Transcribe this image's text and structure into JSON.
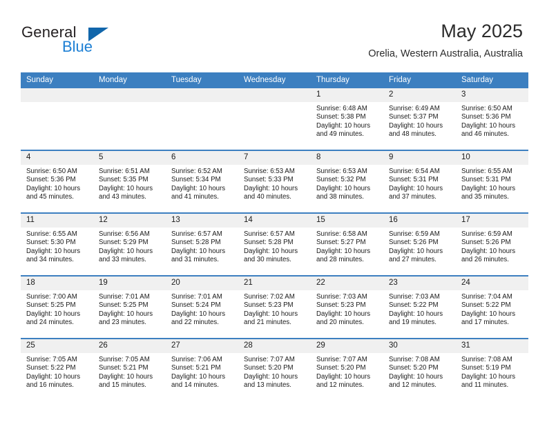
{
  "brand": {
    "word1": "General",
    "word2": "Blue",
    "logo_icon": "triangle-logo-icon",
    "accent_color": "#1c7fd4"
  },
  "header": {
    "title": "May 2025",
    "location": "Orelia, Western Australia, Australia"
  },
  "theme": {
    "header_blue": "#3c7fc0",
    "daynum_band": "#f0f0f0"
  },
  "weekday_headers": [
    "Sunday",
    "Monday",
    "Tuesday",
    "Wednesday",
    "Thursday",
    "Friday",
    "Saturday"
  ],
  "labels": {
    "sunrise_prefix": "Sunrise:",
    "sunset_prefix": "Sunset:",
    "daylight_prefix": "Daylight:"
  },
  "weeks": [
    [
      {
        "empty": true
      },
      {
        "empty": true
      },
      {
        "empty": true
      },
      {
        "empty": true
      },
      {
        "day": "1",
        "sunrise": "Sunrise: 6:48 AM",
        "sunset": "Sunset: 5:38 PM",
        "daylight1": "Daylight: 10 hours",
        "daylight2": "and 49 minutes."
      },
      {
        "day": "2",
        "sunrise": "Sunrise: 6:49 AM",
        "sunset": "Sunset: 5:37 PM",
        "daylight1": "Daylight: 10 hours",
        "daylight2": "and 48 minutes."
      },
      {
        "day": "3",
        "sunrise": "Sunrise: 6:50 AM",
        "sunset": "Sunset: 5:36 PM",
        "daylight1": "Daylight: 10 hours",
        "daylight2": "and 46 minutes."
      }
    ],
    [
      {
        "day": "4",
        "sunrise": "Sunrise: 6:50 AM",
        "sunset": "Sunset: 5:36 PM",
        "daylight1": "Daylight: 10 hours",
        "daylight2": "and 45 minutes."
      },
      {
        "day": "5",
        "sunrise": "Sunrise: 6:51 AM",
        "sunset": "Sunset: 5:35 PM",
        "daylight1": "Daylight: 10 hours",
        "daylight2": "and 43 minutes."
      },
      {
        "day": "6",
        "sunrise": "Sunrise: 6:52 AM",
        "sunset": "Sunset: 5:34 PM",
        "daylight1": "Daylight: 10 hours",
        "daylight2": "and 41 minutes."
      },
      {
        "day": "7",
        "sunrise": "Sunrise: 6:53 AM",
        "sunset": "Sunset: 5:33 PM",
        "daylight1": "Daylight: 10 hours",
        "daylight2": "and 40 minutes."
      },
      {
        "day": "8",
        "sunrise": "Sunrise: 6:53 AM",
        "sunset": "Sunset: 5:32 PM",
        "daylight1": "Daylight: 10 hours",
        "daylight2": "and 38 minutes."
      },
      {
        "day": "9",
        "sunrise": "Sunrise: 6:54 AM",
        "sunset": "Sunset: 5:31 PM",
        "daylight1": "Daylight: 10 hours",
        "daylight2": "and 37 minutes."
      },
      {
        "day": "10",
        "sunrise": "Sunrise: 6:55 AM",
        "sunset": "Sunset: 5:31 PM",
        "daylight1": "Daylight: 10 hours",
        "daylight2": "and 35 minutes."
      }
    ],
    [
      {
        "day": "11",
        "sunrise": "Sunrise: 6:55 AM",
        "sunset": "Sunset: 5:30 PM",
        "daylight1": "Daylight: 10 hours",
        "daylight2": "and 34 minutes."
      },
      {
        "day": "12",
        "sunrise": "Sunrise: 6:56 AM",
        "sunset": "Sunset: 5:29 PM",
        "daylight1": "Daylight: 10 hours",
        "daylight2": "and 33 minutes."
      },
      {
        "day": "13",
        "sunrise": "Sunrise: 6:57 AM",
        "sunset": "Sunset: 5:28 PM",
        "daylight1": "Daylight: 10 hours",
        "daylight2": "and 31 minutes."
      },
      {
        "day": "14",
        "sunrise": "Sunrise: 6:57 AM",
        "sunset": "Sunset: 5:28 PM",
        "daylight1": "Daylight: 10 hours",
        "daylight2": "and 30 minutes."
      },
      {
        "day": "15",
        "sunrise": "Sunrise: 6:58 AM",
        "sunset": "Sunset: 5:27 PM",
        "daylight1": "Daylight: 10 hours",
        "daylight2": "and 28 minutes."
      },
      {
        "day": "16",
        "sunrise": "Sunrise: 6:59 AM",
        "sunset": "Sunset: 5:26 PM",
        "daylight1": "Daylight: 10 hours",
        "daylight2": "and 27 minutes."
      },
      {
        "day": "17",
        "sunrise": "Sunrise: 6:59 AM",
        "sunset": "Sunset: 5:26 PM",
        "daylight1": "Daylight: 10 hours",
        "daylight2": "and 26 minutes."
      }
    ],
    [
      {
        "day": "18",
        "sunrise": "Sunrise: 7:00 AM",
        "sunset": "Sunset: 5:25 PM",
        "daylight1": "Daylight: 10 hours",
        "daylight2": "and 24 minutes."
      },
      {
        "day": "19",
        "sunrise": "Sunrise: 7:01 AM",
        "sunset": "Sunset: 5:25 PM",
        "daylight1": "Daylight: 10 hours",
        "daylight2": "and 23 minutes."
      },
      {
        "day": "20",
        "sunrise": "Sunrise: 7:01 AM",
        "sunset": "Sunset: 5:24 PM",
        "daylight1": "Daylight: 10 hours",
        "daylight2": "and 22 minutes."
      },
      {
        "day": "21",
        "sunrise": "Sunrise: 7:02 AM",
        "sunset": "Sunset: 5:23 PM",
        "daylight1": "Daylight: 10 hours",
        "daylight2": "and 21 minutes."
      },
      {
        "day": "22",
        "sunrise": "Sunrise: 7:03 AM",
        "sunset": "Sunset: 5:23 PM",
        "daylight1": "Daylight: 10 hours",
        "daylight2": "and 20 minutes."
      },
      {
        "day": "23",
        "sunrise": "Sunrise: 7:03 AM",
        "sunset": "Sunset: 5:22 PM",
        "daylight1": "Daylight: 10 hours",
        "daylight2": "and 19 minutes."
      },
      {
        "day": "24",
        "sunrise": "Sunrise: 7:04 AM",
        "sunset": "Sunset: 5:22 PM",
        "daylight1": "Daylight: 10 hours",
        "daylight2": "and 17 minutes."
      }
    ],
    [
      {
        "day": "25",
        "sunrise": "Sunrise: 7:05 AM",
        "sunset": "Sunset: 5:22 PM",
        "daylight1": "Daylight: 10 hours",
        "daylight2": "and 16 minutes."
      },
      {
        "day": "26",
        "sunrise": "Sunrise: 7:05 AM",
        "sunset": "Sunset: 5:21 PM",
        "daylight1": "Daylight: 10 hours",
        "daylight2": "and 15 minutes."
      },
      {
        "day": "27",
        "sunrise": "Sunrise: 7:06 AM",
        "sunset": "Sunset: 5:21 PM",
        "daylight1": "Daylight: 10 hours",
        "daylight2": "and 14 minutes."
      },
      {
        "day": "28",
        "sunrise": "Sunrise: 7:07 AM",
        "sunset": "Sunset: 5:20 PM",
        "daylight1": "Daylight: 10 hours",
        "daylight2": "and 13 minutes."
      },
      {
        "day": "29",
        "sunrise": "Sunrise: 7:07 AM",
        "sunset": "Sunset: 5:20 PM",
        "daylight1": "Daylight: 10 hours",
        "daylight2": "and 12 minutes."
      },
      {
        "day": "30",
        "sunrise": "Sunrise: 7:08 AM",
        "sunset": "Sunset: 5:20 PM",
        "daylight1": "Daylight: 10 hours",
        "daylight2": "and 12 minutes."
      },
      {
        "day": "31",
        "sunrise": "Sunrise: 7:08 AM",
        "sunset": "Sunset: 5:19 PM",
        "daylight1": "Daylight: 10 hours",
        "daylight2": "and 11 minutes."
      }
    ]
  ]
}
